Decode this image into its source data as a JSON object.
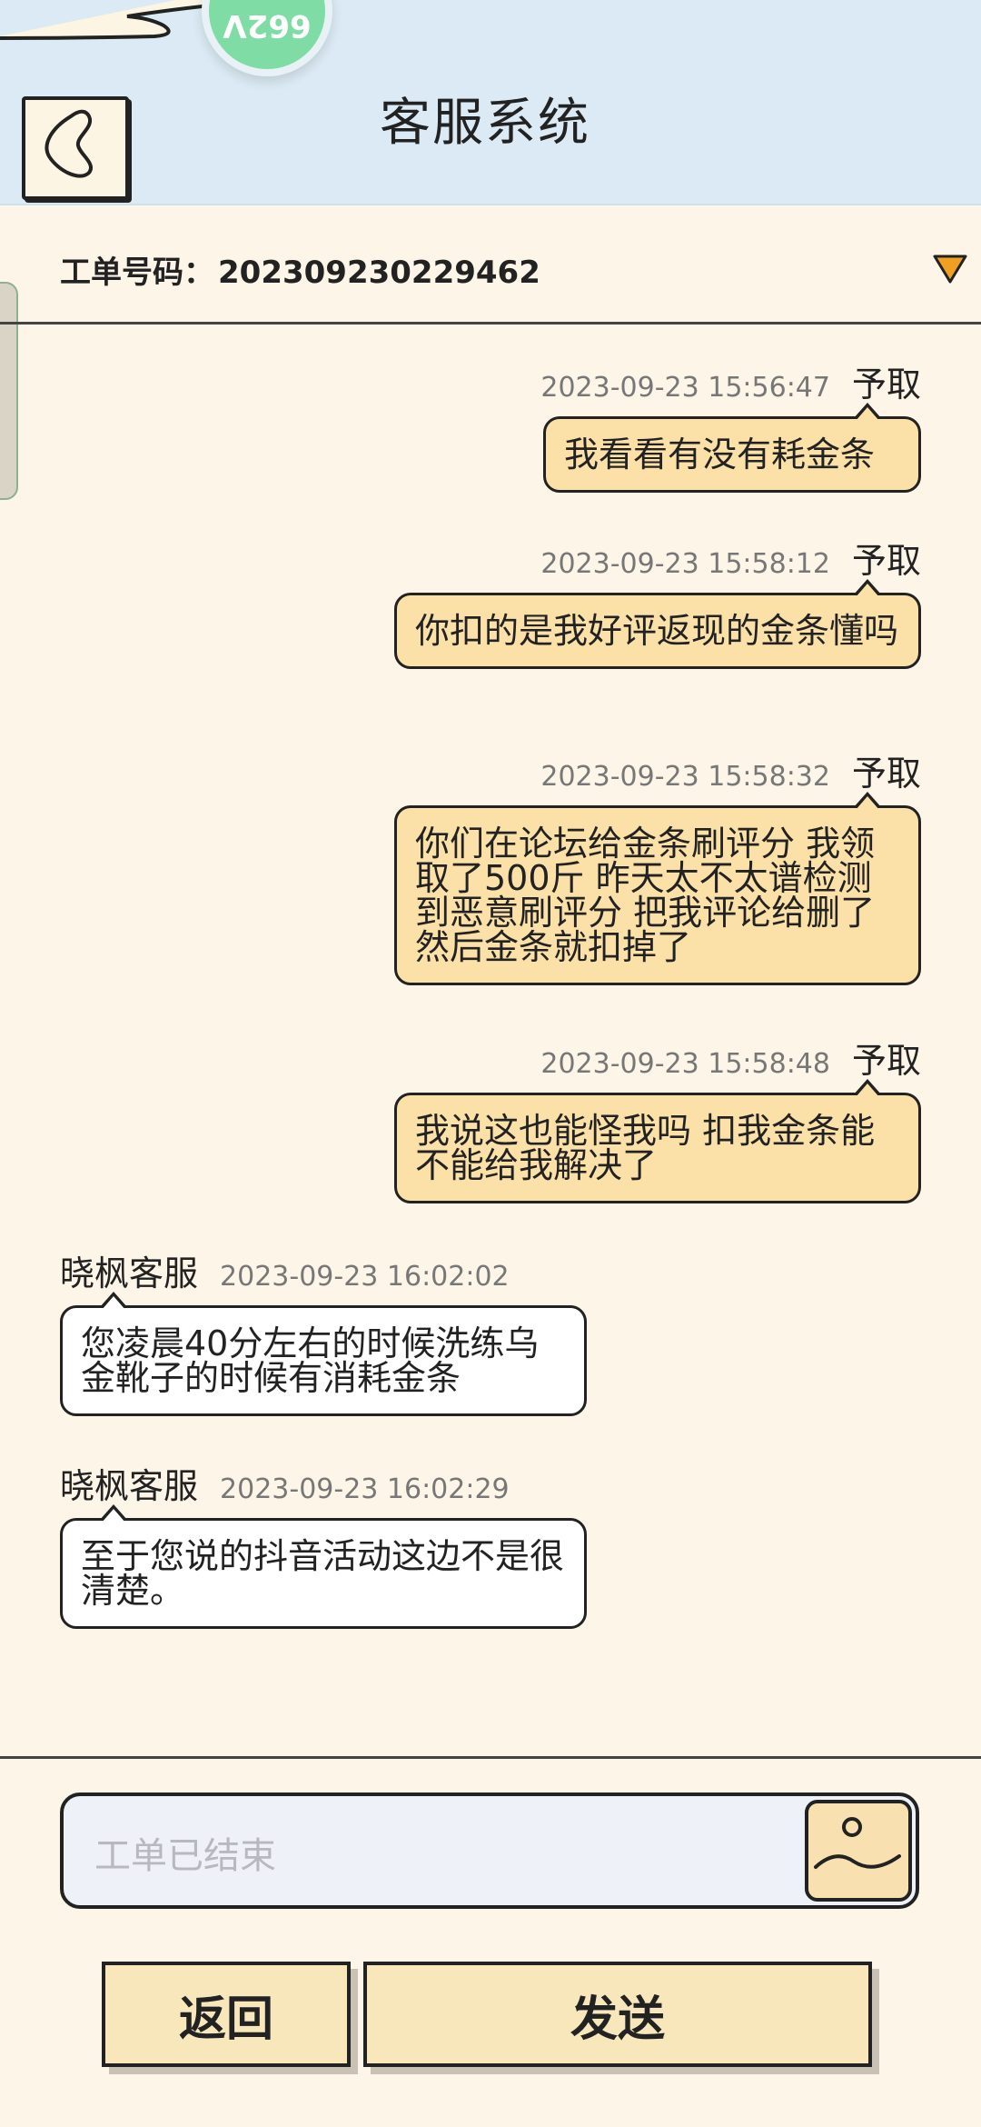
{
  "header": {
    "title": "客服系统",
    "avatar_text": "662V",
    "back_icon": "back-arrow-icon"
  },
  "ticket": {
    "label": "工单号码：",
    "number": "202309230229462"
  },
  "messages": [
    {
      "side": "me",
      "sender": "予取",
      "time": "2023-09-23 15:56:47",
      "text": "我看看有没有耗金条"
    },
    {
      "side": "me",
      "sender": "予取",
      "time": "2023-09-23 15:58:12",
      "text": "你扣的是我好评返现的金条懂吗"
    },
    {
      "side": "me",
      "sender": "予取",
      "time": "2023-09-23 15:58:32",
      "text": "你们在论坛给金条刷评分 我领取了500斤 昨天太不太谱检测到恶意刷评分 把我评论给删了 然后金条就扣掉了"
    },
    {
      "side": "me",
      "sender": "予取",
      "time": "2023-09-23 15:58:48",
      "text": "我说这也能怪我吗 扣我金条能不能给我解决了"
    },
    {
      "side": "other",
      "sender": "晓枫客服",
      "time": "2023-09-23 16:02:02",
      "text": "您凌晨40分左右的时候洗练乌金靴子的时候有消耗金条"
    },
    {
      "side": "other",
      "sender": "晓枫客服",
      "time": "2023-09-23 16:02:29",
      "text": "至于您说的抖音活动这边不是很清楚。"
    }
  ],
  "input": {
    "placeholder": "工单已结束",
    "value": ""
  },
  "buttons": {
    "back_label": "返回",
    "send_label": "发送"
  },
  "colors": {
    "header_bg": "#dbeaf4",
    "page_bg": "#fdf6e8",
    "my_bubble": "#fbe0a8",
    "other_bubble": "#ffffff",
    "button_bg": "#f9e7bc",
    "dropdown": "#f0a020"
  }
}
